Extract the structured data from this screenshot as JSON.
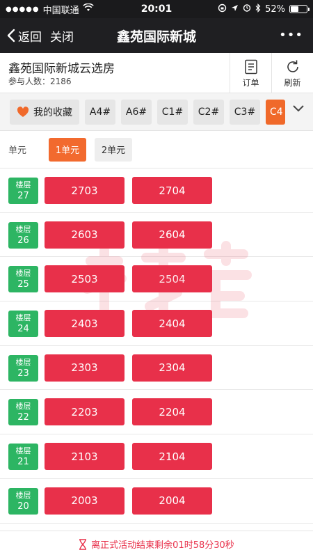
{
  "status_bar": {
    "carrier": "中国联通",
    "time": "20:01",
    "battery": "52%",
    "battery_level": 0.52
  },
  "nav": {
    "back_label": "返回",
    "close_label": "关闭",
    "title": "鑫苑国际新城",
    "more_label": "•••"
  },
  "header": {
    "project_name": "鑫苑国际新城云选房",
    "participants": "参与人数：2186",
    "orders_label": "订单",
    "refresh_label": "刷新"
  },
  "filter": {
    "favorites_label": "我的收藏",
    "buildings": [
      "A4#",
      "A6#",
      "C1#",
      "C2#",
      "C3#",
      "C4"
    ],
    "active_building": "C4"
  },
  "units": {
    "label": "单元",
    "tabs": [
      "1单元",
      "2单元"
    ],
    "active": "1单元"
  },
  "floors": [
    {
      "label": "楼层",
      "floor": "27",
      "rooms": [
        "2703",
        "2704"
      ]
    },
    {
      "label": "楼层",
      "floor": "26",
      "rooms": [
        "2603",
        "2604"
      ]
    },
    {
      "label": "楼层",
      "floor": "25",
      "rooms": [
        "2503",
        "2504"
      ]
    },
    {
      "label": "楼层",
      "floor": "24",
      "rooms": [
        "2403",
        "2404"
      ]
    },
    {
      "label": "楼层",
      "floor": "23",
      "rooms": [
        "2303",
        "2304"
      ]
    },
    {
      "label": "楼层",
      "floor": "22",
      "rooms": [
        "2203",
        "2204"
      ]
    },
    {
      "label": "楼层",
      "floor": "21",
      "rooms": [
        "2103",
        "2104"
      ]
    },
    {
      "label": "楼层",
      "floor": "20",
      "rooms": [
        "2003",
        "2004"
      ]
    }
  ],
  "countdown": {
    "text": "离正式活动结束剩余01时58分30秒"
  },
  "colors": {
    "room": "#e8304a",
    "floor_badge": "#2db563",
    "accent": "#f26a2e",
    "nav_bg": "#1f1f22"
  }
}
